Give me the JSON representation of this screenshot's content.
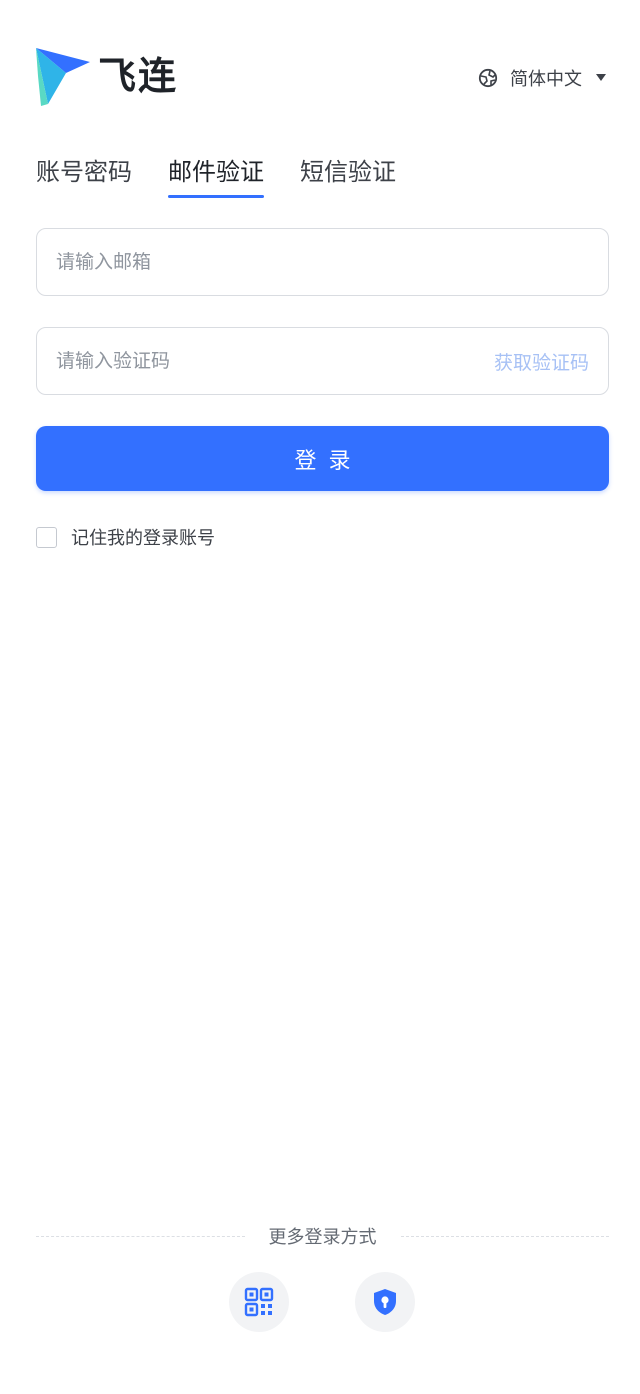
{
  "brand": {
    "name": "飞连"
  },
  "language": {
    "label": "简体中文",
    "icon": "globe-icon"
  },
  "tabs": [
    {
      "label": "账号密码",
      "active": false
    },
    {
      "label": "邮件验证",
      "active": true
    },
    {
      "label": "短信验证",
      "active": false
    }
  ],
  "form": {
    "email_placeholder": "请输入邮箱",
    "email_value": "",
    "code_placeholder": "请输入验证码",
    "code_value": "",
    "get_code_label": "获取验证码",
    "login_label": "登录",
    "remember_label": "记住我的登录账号",
    "remember_checked": false
  },
  "more_login": {
    "label": "更多登录方式",
    "options": [
      {
        "icon": "qr-code-icon"
      },
      {
        "icon": "shield-keyhole-icon"
      }
    ]
  },
  "colors": {
    "accent": "#3370ff",
    "link_muted": "#a7c1f5",
    "text_primary": "#1f2329",
    "border": "#d9dce1"
  }
}
